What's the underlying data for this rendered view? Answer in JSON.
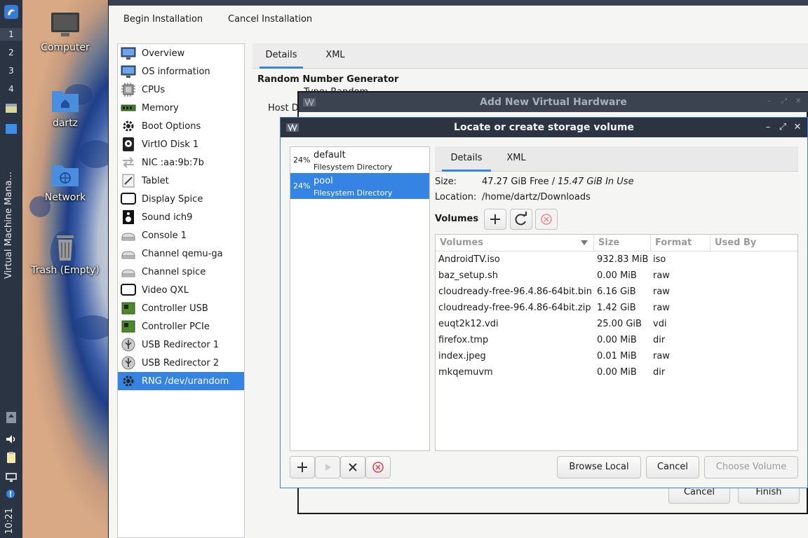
{
  "taskbar": {
    "workspaces": [
      "1",
      "2",
      "3",
      "4"
    ],
    "app_title": "Virtual Machine Mana...",
    "clock": "10:21"
  },
  "desktop": {
    "icons": [
      {
        "label": "Computer",
        "icon": "monitor-icon"
      },
      {
        "label": "dartz",
        "icon": "home-folder-icon"
      },
      {
        "label": "Network",
        "icon": "network-folder-icon"
      },
      {
        "label": "Trash (Empty)",
        "icon": "trash-icon"
      }
    ]
  },
  "main": {
    "menu": {
      "begin": "Begin Installation",
      "cancel": "Cancel Installation"
    },
    "hardware": [
      {
        "label": "Overview",
        "icon": "monitor-icon"
      },
      {
        "label": "OS information",
        "icon": "monitor-icon"
      },
      {
        "label": "CPUs",
        "icon": "cpu-icon"
      },
      {
        "label": "Memory",
        "icon": "memory-icon"
      },
      {
        "label": "Boot Options",
        "icon": "gear-icon"
      },
      {
        "label": "VirtIO Disk 1",
        "icon": "disk-icon"
      },
      {
        "label": "NIC :aa:9b:7b",
        "icon": "nic-arrows-icon"
      },
      {
        "label": "Tablet",
        "icon": "tablet-icon"
      },
      {
        "label": "Display Spice",
        "icon": "display-icon"
      },
      {
        "label": "Sound ich9",
        "icon": "speaker-icon"
      },
      {
        "label": "Console 1",
        "icon": "serial-icon"
      },
      {
        "label": "Channel qemu-ga",
        "icon": "serial-icon"
      },
      {
        "label": "Channel spice",
        "icon": "serial-icon"
      },
      {
        "label": "Video QXL",
        "icon": "display-icon"
      },
      {
        "label": "Controller USB",
        "icon": "controller-card-icon"
      },
      {
        "label": "Controller PCIe",
        "icon": "controller-card-icon"
      },
      {
        "label": "USB Redirector 1",
        "icon": "usb-icon"
      },
      {
        "label": "USB Redirector 2",
        "icon": "usb-icon"
      },
      {
        "label": "RNG /dev/urandom",
        "icon": "gear-icon"
      }
    ],
    "selected_hardware": "RNG /dev/urandom",
    "tabs": [
      "Details",
      "XML"
    ],
    "section_title": "Random Number Generator",
    "type_label_partial": "Type: Random",
    "host_label_partial": "Host D"
  },
  "add_hw": {
    "title": "Add New Virtual Hardware",
    "cancel": "Cancel",
    "finish": "Finish"
  },
  "dialog": {
    "title": "Locate or create storage volume",
    "pools": [
      {
        "pct": "24%",
        "name": "default",
        "type": "Filesystem Directory"
      },
      {
        "pct": "24%",
        "name": "pool",
        "type": "Filesystem Directory"
      }
    ],
    "selected_pool": "pool",
    "tabs": [
      "Details",
      "XML"
    ],
    "size_label": "Size:",
    "size_free": "47.27 GiB Free /",
    "size_used": "15.47 GiB In Use",
    "location_label": "Location:",
    "location_value": "/home/dartz/Downloads",
    "volumes_label": "Volumes",
    "columns": [
      "Volumes",
      "Size",
      "Format",
      "Used By"
    ],
    "volumes": [
      {
        "name": "AndroidTV.iso",
        "size": "932.83 MiB",
        "format": "iso",
        "used_by": ""
      },
      {
        "name": "baz_setup.sh",
        "size": "0.00 MiB",
        "format": "raw",
        "used_by": ""
      },
      {
        "name": "cloudready-free-96.4.86-64bit.bin",
        "size": "6.16 GiB",
        "format": "raw",
        "used_by": ""
      },
      {
        "name": "cloudready-free-96.4.86-64bit.zip",
        "size": "1.42 GiB",
        "format": "raw",
        "used_by": ""
      },
      {
        "name": "euqt2k12.vdi",
        "size": "25.00 GiB",
        "format": "vdi",
        "used_by": ""
      },
      {
        "name": "firefox.tmp",
        "size": "0.00 MiB",
        "format": "dir",
        "used_by": ""
      },
      {
        "name": "index.jpeg",
        "size": "0.01 MiB",
        "format": "raw",
        "used_by": ""
      },
      {
        "name": "mkqemuvm",
        "size": "0.00 MiB",
        "format": "dir",
        "used_by": ""
      }
    ],
    "browse_local": "Browse Local",
    "cancel": "Cancel",
    "choose_volume": "Choose Volume"
  },
  "colors": {
    "accent": "#3584e4",
    "titlebar": "#2d3441",
    "delete_red": "#e0434b"
  }
}
